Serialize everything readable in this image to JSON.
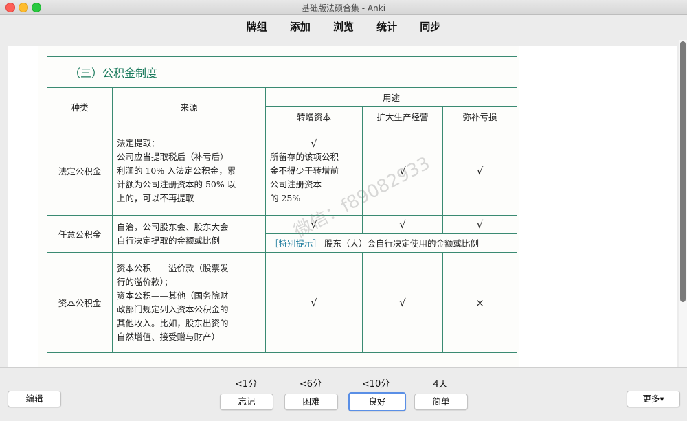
{
  "window": {
    "title": "基础版法硕合集 - Anki"
  },
  "toolbar": {
    "links": [
      "牌组",
      "添加",
      "浏览",
      "统计",
      "同步"
    ]
  },
  "card": {
    "section_title": "（三）公积金制度",
    "headers": {
      "type": "种类",
      "source": "来源",
      "usage": "用途",
      "u1": "转增资本",
      "u2": "扩大生产经营",
      "u3": "弥补亏损"
    },
    "rows": [
      {
        "type": "法定公积金",
        "source": [
          "法定提取：",
          "公司应当提取税后（补亏后）",
          "利润的 10% 入法定公积金，累",
          "计额为公司注册资本的 50% 以",
          "上的，可以不再提取"
        ],
        "u1": [
          "√",
          "所留存的该项公积",
          "金不得少于转增前",
          "公司注册资本",
          "的 25%"
        ],
        "u2": "√",
        "u3": "√"
      },
      {
        "type": "任意公积金",
        "source": [
          "自治，公司股东会、股东大会",
          "自行决定提取的金额或比例"
        ],
        "u1": "√",
        "u2": "√",
        "u3": "√",
        "tip_label": "［特别提示］",
        "tip_text": "股东（大）会自行决定使用的金额或比例"
      },
      {
        "type": "资本公积金",
        "source": [
          "资本公积——溢价款（股票发",
          "行的溢价款）；",
          "资本公积——其他（国务院财",
          "政部门规定列入资本公积金的",
          "其他收入。比如，股东出资的",
          "自然增值、接受赠与财产）"
        ],
        "u1": "√",
        "u2": "√",
        "u3": "×"
      }
    ],
    "watermark": "微信：f89082933"
  },
  "footer": {
    "edit_label": "编辑",
    "more_label": "更多▾",
    "answers": [
      {
        "interval": "<1分",
        "label": "忘记"
      },
      {
        "interval": "<6分",
        "label": "困难"
      },
      {
        "interval": "<10分",
        "label": "良好"
      },
      {
        "interval": "4天",
        "label": "简单"
      }
    ]
  }
}
